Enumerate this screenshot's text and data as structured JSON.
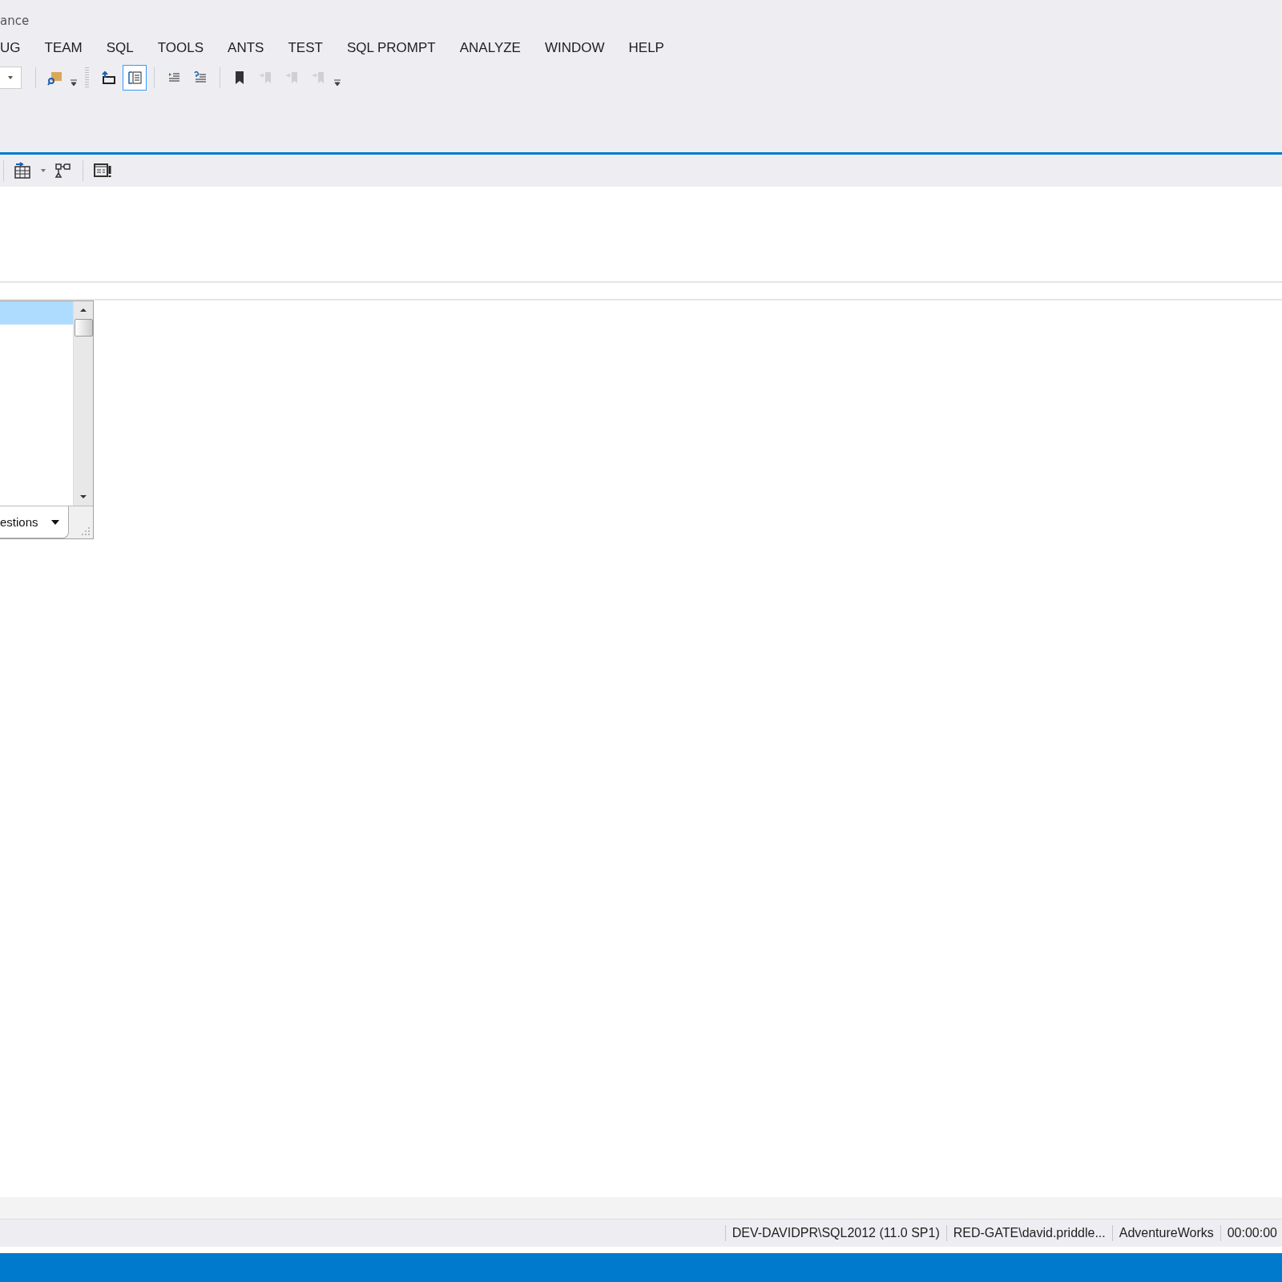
{
  "window": {
    "title": "ance"
  },
  "menu": [
    {
      "label": "UG"
    },
    {
      "label": "TEAM"
    },
    {
      "label": "SQL"
    },
    {
      "label": "TOOLS"
    },
    {
      "label": "ANTS"
    },
    {
      "label": "TEST"
    },
    {
      "label": "SQL PROMPT"
    },
    {
      "label": "ANALYZE"
    },
    {
      "label": "WINDOW"
    },
    {
      "label": "HELP"
    }
  ],
  "toolbar": [
    {
      "kind": "combo"
    },
    {
      "kind": "sep"
    },
    {
      "kind": "find",
      "selected": false,
      "disabled": false
    },
    {
      "kind": "dropdown"
    },
    {
      "kind": "grip"
    },
    {
      "kind": "panel",
      "selected": false,
      "disabled": false
    },
    {
      "kind": "results",
      "selected": true,
      "disabled": false
    },
    {
      "kind": "sep"
    },
    {
      "kind": "indent",
      "selected": false,
      "disabled": false
    },
    {
      "kind": "comment",
      "selected": false,
      "disabled": false
    },
    {
      "kind": "sep"
    },
    {
      "kind": "bookmark",
      "selected": false,
      "disabled": false
    },
    {
      "kind": "prev",
      "selected": false,
      "disabled": true
    },
    {
      "kind": "next",
      "selected": false,
      "disabled": true
    },
    {
      "kind": "clear",
      "selected": false,
      "disabled": true
    },
    {
      "kind": "dropdown"
    }
  ],
  "suggestions": {
    "rows": [
      {
        "selected": true
      }
    ],
    "filter": "estions"
  },
  "status_bar": {
    "items": [
      "DEV-DAVIDPR\\SQL2012 (11.0 SP1)",
      "RED-GATE\\david.priddle...",
      "AdventureWorks",
      "00:00:00"
    ]
  }
}
